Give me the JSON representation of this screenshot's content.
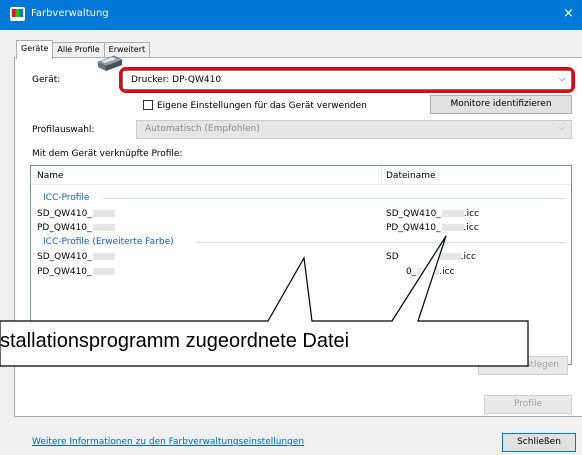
{
  "window": {
    "title": "Farbverwaltung",
    "close_glyph": "×"
  },
  "tabs": [
    {
      "label": "Geräte",
      "active": true
    },
    {
      "label": "Alle Profile",
      "active": false
    },
    {
      "label": "Erweitert",
      "active": false
    }
  ],
  "device": {
    "label": "Gerät:",
    "value": "Drucker: DP-QW410",
    "checkbox_label": "Eigene Einstellungen für das Gerät verwenden",
    "checked": false,
    "identify_button": "Monitore identifizieren"
  },
  "profile_selection": {
    "label": "Profilauswahl:",
    "value": "Automatisch (Empfohlen)"
  },
  "profiles_list": {
    "caption": "Mit dem Gerät verknüpfte Profile:",
    "columns": [
      "Name",
      "Dateiname"
    ],
    "groups": [
      {
        "title": "ICC-Profile",
        "rows": [
          {
            "name": "SD_QW410_",
            "file": "SD_QW410_",
            "ext": ".icc"
          },
          {
            "name": "PD_QW410_",
            "file": "PD_QW410_",
            "ext": ".icc"
          }
        ]
      },
      {
        "title": "ICC-Profile (Erweiterte Farbe)",
        "rows": [
          {
            "name": "SD_QW410_",
            "file": "SD",
            "ext": ".icc"
          },
          {
            "name": "PD_QW410_",
            "file": "0_",
            "ext": ".icc"
          }
        ]
      }
    ]
  },
  "callout": {
    "text": "stallationsprogramm zugeordnete Datei"
  },
  "buttons": {
    "set_default_partial": "stlegen",
    "profiles": "Profile",
    "close": "Schließen"
  },
  "footer_link": "Weitere Informationen zu den Farbverwaltungseinstellungen",
  "colors": {
    "titlebar": "#0078d7",
    "highlight": "#e30613",
    "link": "#0066cc"
  }
}
